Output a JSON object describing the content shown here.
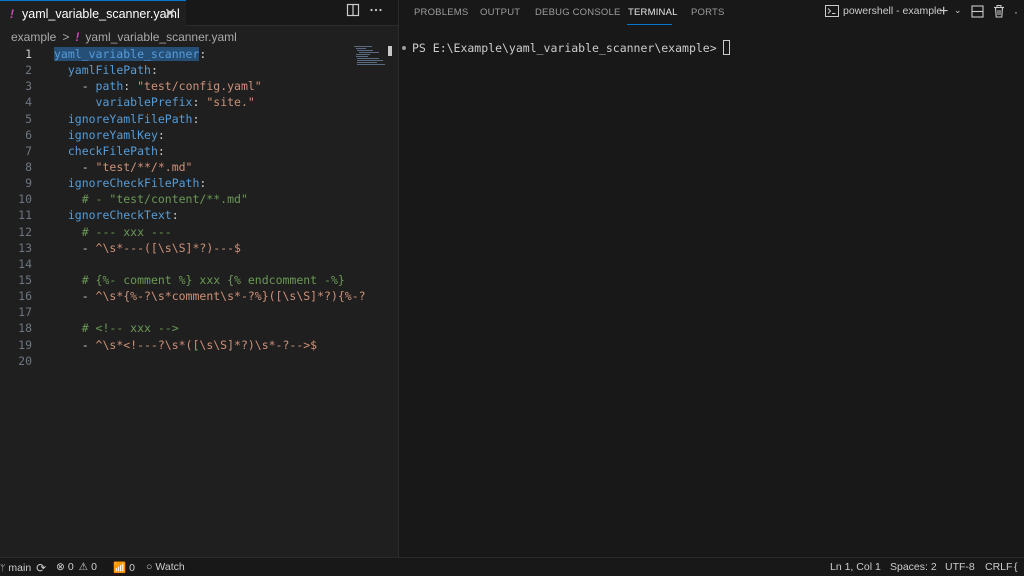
{
  "editor": {
    "tab": {
      "title": "yaml_variable_scanner.yaml",
      "icon": "yaml-file-icon",
      "close": "✕"
    },
    "breadcrumb": {
      "folder": "example",
      "file": "yaml_variable_scanner.yaml"
    },
    "active_line": 1,
    "lines": [
      {
        "n": "1",
        "parts": [
          {
            "c": "sel",
            "t": "yaml_variable_scanner"
          },
          {
            "c": "pl",
            "t": ":"
          }
        ]
      },
      {
        "n": "2",
        "parts": [
          {
            "c": "pl",
            "t": "  "
          },
          {
            "c": "key",
            "t": "yamlFilePath"
          },
          {
            "c": "pl",
            "t": ":"
          }
        ]
      },
      {
        "n": "3",
        "parts": [
          {
            "c": "pl",
            "t": "    - "
          },
          {
            "c": "key",
            "t": "path"
          },
          {
            "c": "pl",
            "t": ": "
          },
          {
            "c": "str",
            "t": "\"test/config.yaml\""
          }
        ]
      },
      {
        "n": "4",
        "parts": [
          {
            "c": "pl",
            "t": "      "
          },
          {
            "c": "key",
            "t": "variablePrefix"
          },
          {
            "c": "pl",
            "t": ": "
          },
          {
            "c": "str",
            "t": "\"site.\""
          }
        ]
      },
      {
        "n": "5",
        "parts": [
          {
            "c": "pl",
            "t": "  "
          },
          {
            "c": "key",
            "t": "ignoreYamlFilePath"
          },
          {
            "c": "pl",
            "t": ":"
          }
        ]
      },
      {
        "n": "6",
        "parts": [
          {
            "c": "pl",
            "t": "  "
          },
          {
            "c": "key",
            "t": "ignoreYamlKey"
          },
          {
            "c": "pl",
            "t": ":"
          }
        ]
      },
      {
        "n": "7",
        "parts": [
          {
            "c": "pl",
            "t": "  "
          },
          {
            "c": "key",
            "t": "checkFilePath"
          },
          {
            "c": "pl",
            "t": ":"
          }
        ]
      },
      {
        "n": "8",
        "parts": [
          {
            "c": "pl",
            "t": "    - "
          },
          {
            "c": "str",
            "t": "\"test/**/*.md\""
          }
        ]
      },
      {
        "n": "9",
        "parts": [
          {
            "c": "pl",
            "t": "  "
          },
          {
            "c": "key",
            "t": "ignoreCheckFilePath"
          },
          {
            "c": "pl",
            "t": ":"
          }
        ]
      },
      {
        "n": "10",
        "parts": [
          {
            "c": "pl",
            "t": "    "
          },
          {
            "c": "cm",
            "t": "# - \"test/content/**.md\""
          }
        ]
      },
      {
        "n": "11",
        "parts": [
          {
            "c": "pl",
            "t": "  "
          },
          {
            "c": "key",
            "t": "ignoreCheckText"
          },
          {
            "c": "pl",
            "t": ":"
          }
        ]
      },
      {
        "n": "12",
        "parts": [
          {
            "c": "pl",
            "t": "    "
          },
          {
            "c": "cm",
            "t": "# --- xxx ---"
          }
        ]
      },
      {
        "n": "13",
        "parts": [
          {
            "c": "pl",
            "t": "    - "
          },
          {
            "c": "str",
            "t": "^\\s*---([\\s\\S]*?)---$"
          }
        ]
      },
      {
        "n": "14",
        "parts": []
      },
      {
        "n": "15",
        "parts": [
          {
            "c": "pl",
            "t": "    "
          },
          {
            "c": "cm",
            "t": "# {%- comment %} xxx {% endcomment -%}"
          }
        ]
      },
      {
        "n": "16",
        "parts": [
          {
            "c": "pl",
            "t": "    - "
          },
          {
            "c": "str",
            "t": "^\\s*{%-?\\s*comment\\s*-?%}([\\s\\S]*?){%-?"
          }
        ]
      },
      {
        "n": "17",
        "parts": []
      },
      {
        "n": "18",
        "parts": [
          {
            "c": "pl",
            "t": "    "
          },
          {
            "c": "cm",
            "t": "# <!-- xxx -->"
          }
        ]
      },
      {
        "n": "19",
        "parts": [
          {
            "c": "pl",
            "t": "    - "
          },
          {
            "c": "str",
            "t": "^\\s*<!---?\\s*([\\s\\S]*?)\\s*-?-->$"
          }
        ]
      },
      {
        "n": "20",
        "parts": []
      }
    ]
  },
  "panel": {
    "tabs": [
      "PROBLEMS",
      "OUTPUT",
      "DEBUG CONSOLE",
      "TERMINAL",
      "PORTS"
    ],
    "active_tab": "TERMINAL",
    "terminal_name": "powershell - example",
    "prompt": "PS E:\\Example\\yaml_variable_scanner\\example> "
  },
  "statusbar": {
    "branch": "main",
    "errors": "0",
    "warnings": "0",
    "ports": "0",
    "watch": "Watch",
    "position": "Ln 1, Col 1",
    "spaces": "Spaces: 2",
    "encoding": "UTF-8",
    "eol": "CRLF"
  },
  "colors": {
    "accent": "#0078d4",
    "key": "#569cd6",
    "string": "#ce9178",
    "comment": "#6a9955",
    "yaml_icon": "#cb4ab5"
  }
}
